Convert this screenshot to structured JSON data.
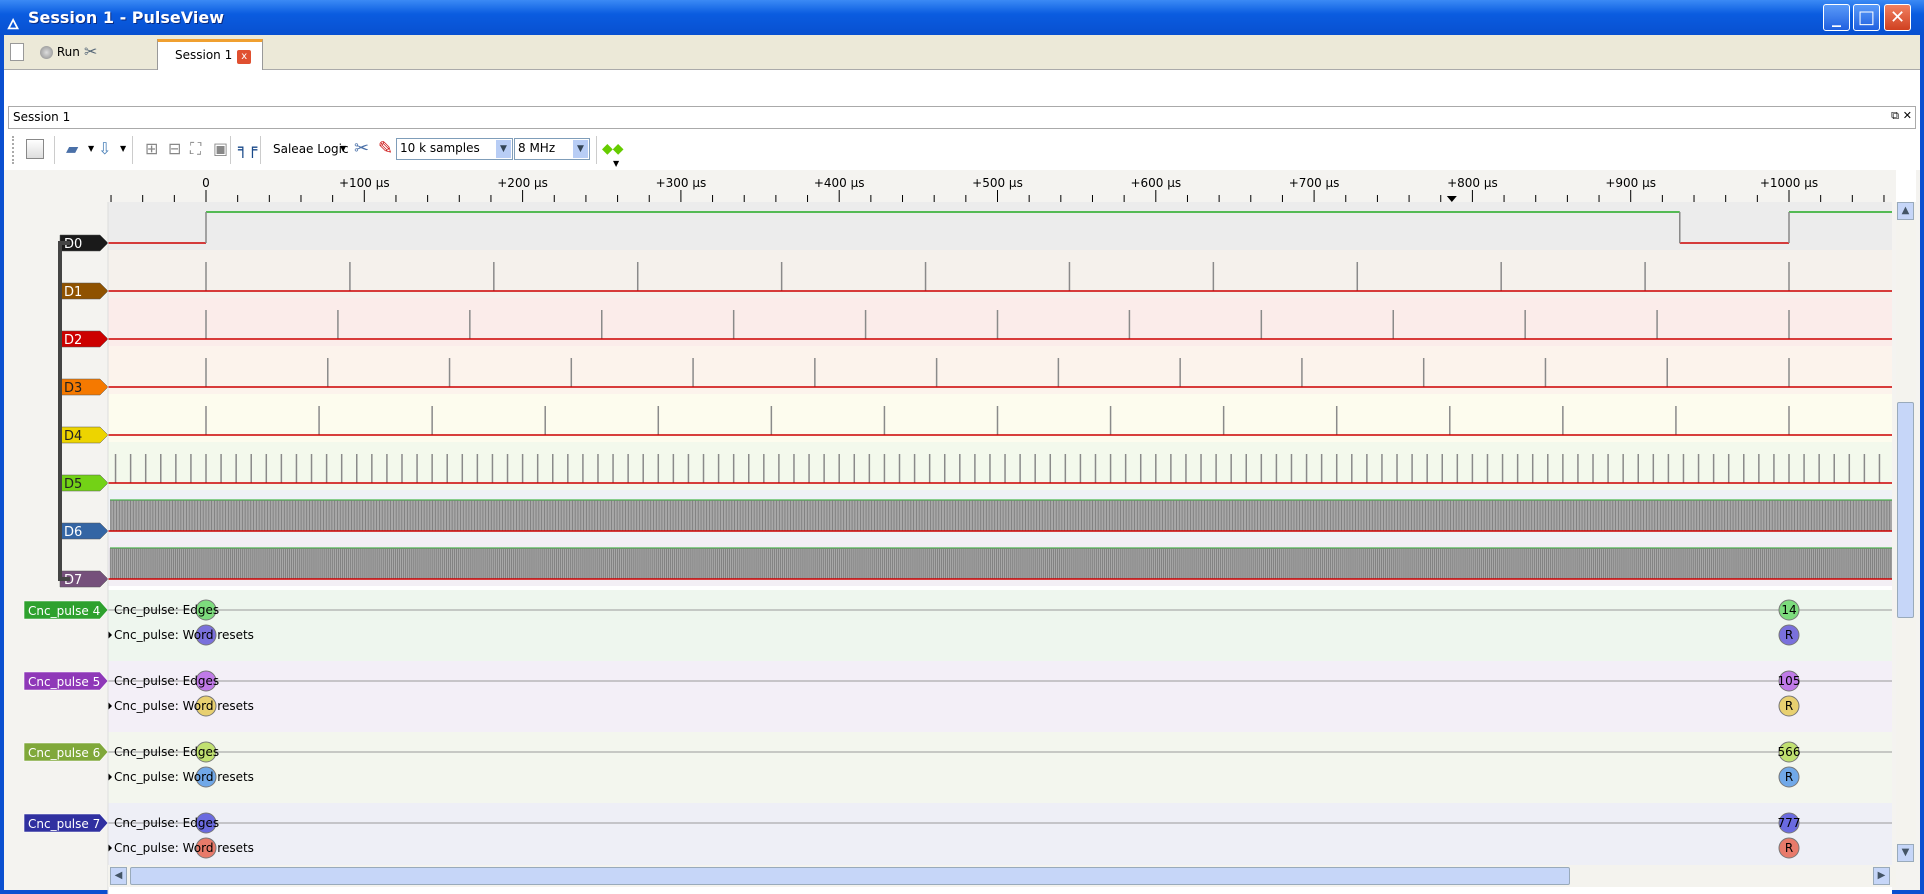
{
  "window": {
    "title": "Session 1 - PulseView",
    "minimize": "_",
    "maximize": "□",
    "close": "✕"
  },
  "tabbar": {
    "run_label": "Run",
    "session_tab": "Session 1",
    "tab_close": "x"
  },
  "session_label": "Session 1",
  "session_controls": {
    "float": "⧉",
    "close": "✕"
  },
  "toolbar": {
    "device": "Saleae Logic",
    "samples": "10 k samples",
    "samplerate": "8 MHz"
  },
  "ruler": {
    "labels": [
      "0",
      "+100 µs",
      "+200 µs",
      "+300 µs",
      "+400 µs",
      "+500 µs",
      "+600 µs",
      "+700 µs",
      "+800 µs",
      "+900 µs",
      "+1000 µs"
    ],
    "trigger_marker_us": 787
  },
  "channels": [
    {
      "name": "D0",
      "color": "#1a1a1a",
      "bg": "#ececec",
      "kind": "level",
      "transitions_us": [
        0,
        931,
        1000
      ]
    },
    {
      "name": "D1",
      "color": "#8f5200",
      "bg": "#f5f1ec",
      "kind": "pulses",
      "count": 11
    },
    {
      "name": "D2",
      "color": "#cc0000",
      "bg": "#fbecea",
      "kind": "pulses",
      "count": 12
    },
    {
      "name": "D3",
      "color": "#f57900",
      "bg": "#fcf3ec",
      "kind": "pulses",
      "count": 13
    },
    {
      "name": "D4",
      "color": "#edd400",
      "bg": "#fdfcee",
      "kind": "pulses",
      "count": 14
    },
    {
      "name": "D5",
      "color": "#73d216",
      "bg": "#f3f9ec",
      "kind": "pulses",
      "count": 105
    },
    {
      "name": "D6",
      "color": "#3465a4",
      "bg": "#eff2f6",
      "kind": "pulses",
      "count": 566
    },
    {
      "name": "D7",
      "color": "#75507b",
      "bg": "#f3eff5",
      "kind": "pulses",
      "count": 777
    }
  ],
  "decoders": [
    {
      "name": "Cnc_pulse 4",
      "color": "#2ea12e",
      "bg": "#eef6ee",
      "edges_label": "Cnc_pulse: Edges",
      "resets_label": "Cnc_pulse: Word resets",
      "edge_color": "#7ddc7d",
      "reset_color": "#7a70dc",
      "count": "14",
      "reset": "R"
    },
    {
      "name": "Cnc_pulse 5",
      "color": "#8f38b8",
      "bg": "#f3eff7",
      "edges_label": "Cnc_pulse: Edges",
      "resets_label": "Cnc_pulse: Word resets",
      "edge_color": "#c07ae8",
      "reset_color": "#e8d070",
      "count": "105",
      "reset": "R"
    },
    {
      "name": "Cnc_pulse 6",
      "color": "#80a83a",
      "bg": "#f3f6ee",
      "edges_label": "Cnc_pulse: Edges",
      "resets_label": "Cnc_pulse: Word resets",
      "edge_color": "#c0e070",
      "reset_color": "#70a8e8",
      "count": "566",
      "reset": "R"
    },
    {
      "name": "Cnc_pulse 7",
      "color": "#3030a0",
      "bg": "#eeeff6",
      "edges_label": "Cnc_pulse: Edges",
      "resets_label": "Cnc_pulse: Word resets",
      "edge_color": "#6a6ae0",
      "reset_color": "#e87a6a",
      "count": "777",
      "reset": "R"
    }
  ]
}
